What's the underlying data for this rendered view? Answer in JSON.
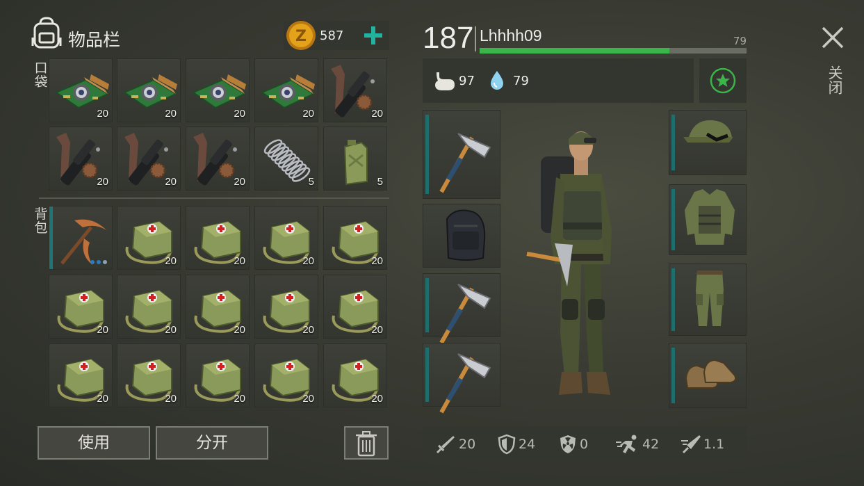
{
  "header": {
    "title": "物品栏",
    "coins": "587",
    "level": "187",
    "username": "Lhhhh09",
    "xp_value": "79",
    "xp_progress": 0.71,
    "hunger": "97",
    "thirst": "79",
    "close_label": "关闭"
  },
  "sections": {
    "pockets": "口袋",
    "backpack": "背包"
  },
  "pockets": [
    {
      "item": "circuit-board",
      "count": "20"
    },
    {
      "item": "circuit-board",
      "count": "20"
    },
    {
      "item": "circuit-board",
      "count": "20"
    },
    {
      "item": "circuit-board",
      "count": "20"
    },
    {
      "item": "gun-parts",
      "count": "20"
    },
    {
      "item": "gun-parts",
      "count": "20"
    },
    {
      "item": "gun-parts",
      "count": "20"
    },
    {
      "item": "gun-parts",
      "count": "20"
    },
    {
      "item": "spring",
      "count": "5"
    },
    {
      "item": "jerrycan",
      "count": "5"
    }
  ],
  "backpack": [
    {
      "item": "pickaxe",
      "count": ""
    },
    {
      "item": "medkit-bag",
      "count": "20"
    },
    {
      "item": "medkit-bag",
      "count": "20"
    },
    {
      "item": "medkit-bag",
      "count": "20"
    },
    {
      "item": "medkit-bag",
      "count": "20"
    },
    {
      "item": "medkit-bag",
      "count": "20"
    },
    {
      "item": "medkit-bag",
      "count": "20"
    },
    {
      "item": "medkit-bag",
      "count": "20"
    },
    {
      "item": "medkit-bag",
      "count": "20"
    },
    {
      "item": "medkit-bag",
      "count": "20"
    },
    {
      "item": "medkit-bag",
      "count": "20"
    },
    {
      "item": "medkit-bag",
      "count": "20"
    },
    {
      "item": "medkit-bag",
      "count": "20"
    },
    {
      "item": "medkit-bag",
      "count": "20"
    },
    {
      "item": "medkit-bag",
      "count": "20"
    }
  ],
  "buttons": {
    "use": "使用",
    "split": "分开"
  },
  "equipment_left": [
    "hatchet",
    "tactical-backpack",
    "hatchet",
    "hatchet"
  ],
  "equipment_right": [
    "camo-cap",
    "camo-vest",
    "camo-pants",
    "boots"
  ],
  "stats": {
    "attack": "20",
    "defense": "24",
    "radiation": "0",
    "speed": "42",
    "stealth": "1.1"
  },
  "colors": {
    "accent_green": "#3bb54a",
    "slot_teal": "#1f7575",
    "coin_gold": "#e3a21a"
  }
}
